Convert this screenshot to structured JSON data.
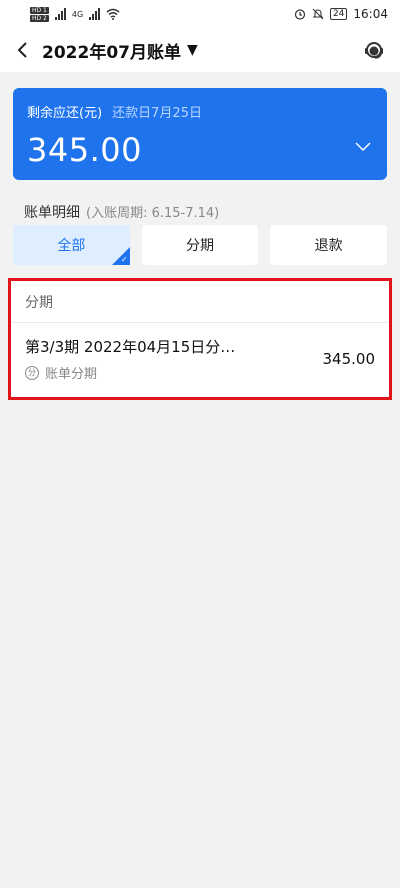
{
  "status": {
    "time": "16:04",
    "battery": "24",
    "hd1": "HD 1",
    "hd2": "HD 2",
    "net": "4G"
  },
  "header": {
    "title": "2022年07月账单",
    "caret": "▼"
  },
  "card": {
    "label": "剩余应还(元)",
    "due": "还款日7月25日",
    "amount": "345.00"
  },
  "section": {
    "title": "账单明细",
    "period": "(入账周期: 6.15-7.14)"
  },
  "tabs": [
    {
      "label": "全部"
    },
    {
      "label": "分期"
    },
    {
      "label": "退款"
    }
  ],
  "list": {
    "header": "分期",
    "rows": [
      {
        "title": "第3/3期 2022年04月15日分…",
        "sub": "账单分期",
        "badge": "分",
        "amount": "345.00"
      }
    ]
  },
  "colors": {
    "accent": "#1f74ee",
    "highlight_border": "#e1141b",
    "active_tab_bg": "#dfeeff"
  }
}
